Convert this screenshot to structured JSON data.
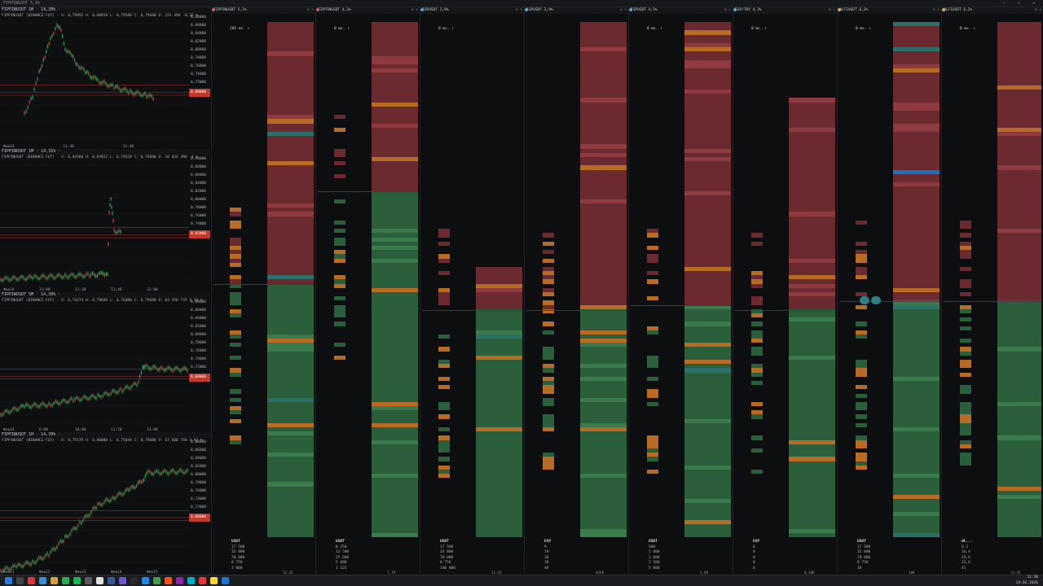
{
  "window": {
    "title": "FIPPINUSDT 5,0%",
    "controls": "— ▢ ✕"
  },
  "charts": [
    {
      "symbol": "FIPPINUSDT 1M · 14,39% ·",
      "ohlc": "FIPPINUSDT (BINANCE-FUT) · O: 0,79892 H: 0,80058 L: 0,79588 C: 0,79680 V: 151 496 -0,32 %",
      "prices": [
        "0,88000",
        "0,86000",
        "0,84000",
        "0,82000",
        "0,80000",
        "0,78000",
        "0,76000",
        "0,74000",
        "0,72000"
      ],
      "times": [
        "Фев24",
        "11:30",
        "11:40"
      ]
    },
    {
      "symbol": "FIPPINUSDT 1М · 14,31% ·",
      "ohlc": "FIPPINUSDT (BINANCE-FUT) · O: 0,82966 H: 0,83922 L: 0,79528 C: 0,79680 V: 10 824 498 -4 %",
      "prices": [
        "0,90000",
        "0,88000",
        "0,86000",
        "0,84000",
        "0,82000",
        "0,80000",
        "0,78000",
        "0,76000",
        "0,74000"
      ],
      "times": [
        "Фев24",
        "11:00",
        "11:30",
        "11:40",
        "12:00"
      ]
    },
    {
      "symbol": "FIPPINUSDT 5M · 14,39% ·",
      "ohlc": "FIPPINUSDT (BINANCE-FUT) · O: 0,76474 H: 0,79680 L: 0,76000 C: 0,79680 V: 64 450 735 4,18 %",
      "prices": [
        "0,88000",
        "0,86000",
        "0,84000",
        "0,82000",
        "0,80000",
        "0,78000",
        "0,76000",
        "0,74000",
        "0,72000"
      ],
      "times": [
        "Фев24",
        "6:00",
        "10:00",
        "11:20",
        "12:00"
      ]
    },
    {
      "symbol": "FIPPINUSDT 1H · 14,39% ·",
      "ohlc": "FIPPINUSDT (BINANCE-FUT) · O: 0,75579 H: 0,80000 L: 0,75044 C: 0,79680 V: 67 800 740 4,92 %",
      "prices": [
        "0,88000",
        "0,86000",
        "0,84000",
        "0,82000",
        "0,80000",
        "0,78000",
        "0,76000",
        "0,74000",
        "0,72000"
      ],
      "times": [
        "Фев21",
        "Фев22",
        "Фев23",
        "Фев24",
        "Фев25"
      ]
    }
  ],
  "doms": [
    {
      "title": "FIPPINUSDT 5,1%",
      "ms": "201 мс. ↑",
      "label": "USDT",
      "bottom": [
        "17 500",
        "35 000",
        "70 000",
        "8 750",
        "3 000"
      ],
      "ts": "11:35",
      "accent": "#d94a4a"
    },
    {
      "title": "FIPPINUSDT 4,2%",
      "ms": "0 мс. ↑",
      "label": "USDT",
      "bottom": [
        "8 250",
        "12 500",
        "25 000",
        "5 000",
        "1 125"
      ],
      "ts": "7,7M",
      "accent": "#d94a4a"
    },
    {
      "title": "ESPUSDT 3,8%",
      "ms": "0 мс. ↑",
      "label": "USDT",
      "bottom": [
        "17 500",
        "35 000",
        "70 000",
        "8 750",
        "140 000"
      ],
      "ts": "11:35",
      "accent": "#3aa0d9"
    },
    {
      "title": "ESPUSDT 3,9%",
      "ms": "",
      "label": "ESP",
      "bottom": [
        "9",
        "19",
        "38",
        "38",
        "48"
      ],
      "ts": "426K",
      "accent": "#3aa0d9"
    },
    {
      "title": "ESPUSDT 4,5%",
      "ms": "0 мс. ↑",
      "label": "USDT",
      "bottom": [
        "500",
        "1 000",
        "2 000",
        "2 500",
        "5 000"
      ],
      "ts": "1,8M",
      "accent": "#3aa0d9"
    },
    {
      "title": "ESP/TRY 4,3%",
      "ms": "0 мс. ↑",
      "label": "ESP",
      "bottom": [
        "0",
        "0",
        "0",
        "0",
        "0"
      ],
      "ts": "8,38K",
      "accent": "#3aa0d9"
    },
    {
      "title": "WLFIUSDT 6,2%",
      "ms": "0 мс. ↑",
      "label": "USDT",
      "bottom": [
        "17 500",
        "35 000",
        "70 000",
        "8 750",
        "10"
      ],
      "ts": "18K",
      "accent": "#d9a03a"
    },
    {
      "title": "WLFIUSDT 6,2%",
      "ms": "0 мс. ↑",
      "label": "WL...",
      "bottom": [
        "8,2",
        "16,4",
        "24,6",
        "32,8",
        "41"
      ],
      "ts": "11:35",
      "accent": "#d9a03a"
    }
  ],
  "taskbar": {
    "time": "11:38",
    "date": "24.02.2026"
  }
}
